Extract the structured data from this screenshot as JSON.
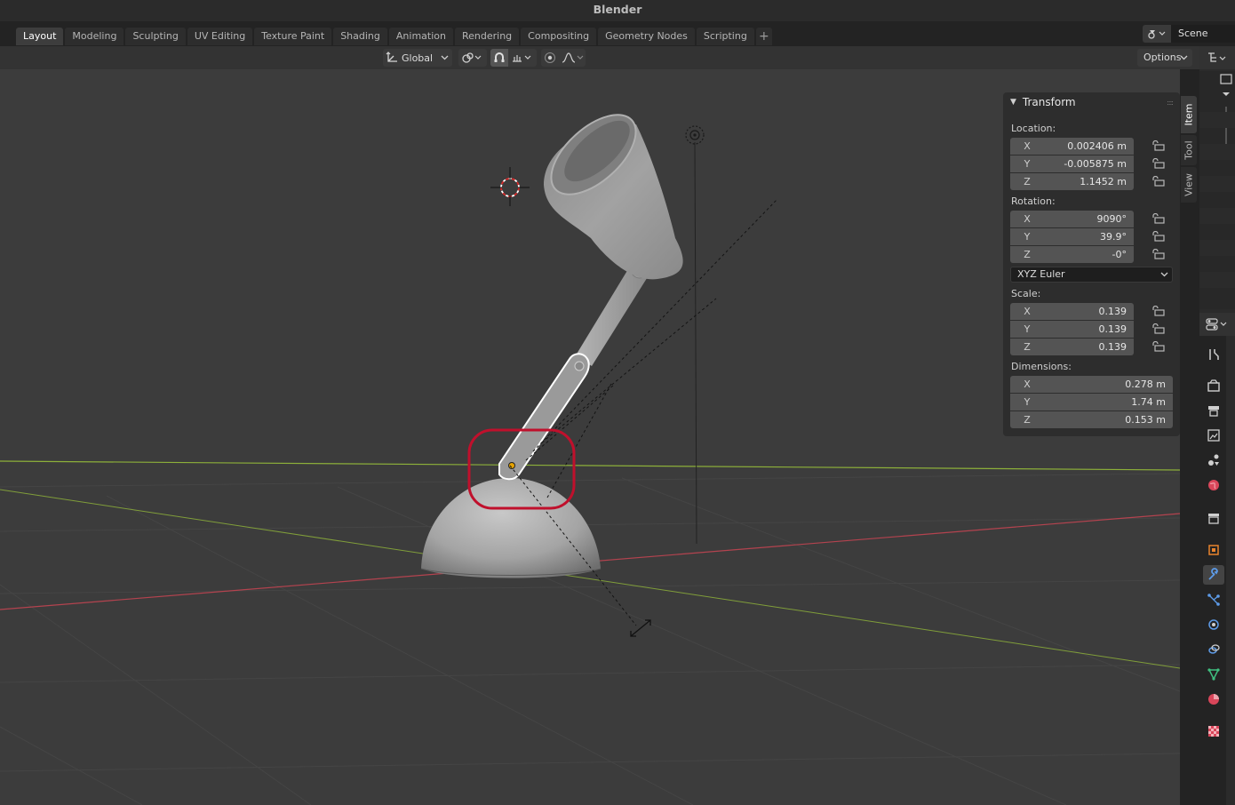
{
  "app": {
    "title": "Blender"
  },
  "workspace_tabs": [
    {
      "label": "Layout",
      "active": true
    },
    {
      "label": "Modeling"
    },
    {
      "label": "Sculpting"
    },
    {
      "label": "UV Editing"
    },
    {
      "label": "Texture Paint"
    },
    {
      "label": "Shading"
    },
    {
      "label": "Animation"
    },
    {
      "label": "Rendering"
    },
    {
      "label": "Compositing"
    },
    {
      "label": "Geometry Nodes"
    },
    {
      "label": "Scripting"
    }
  ],
  "add_workspace": "+",
  "scene": {
    "name": "Scene"
  },
  "header": {
    "orientation": "Global",
    "options_label": "Options"
  },
  "n_panel": {
    "section_title": "Transform",
    "location": {
      "label": "Location:",
      "x": "0.002406 m",
      "y": "-0.005875 m",
      "z": "1.1452 m"
    },
    "rotation": {
      "label": "Rotation:",
      "x": "9090°",
      "y": "39.9°",
      "z": "-0°"
    },
    "rotation_mode": "XYZ Euler",
    "scale": {
      "label": "Scale:",
      "x": "0.139",
      "y": "0.139",
      "z": "0.139"
    },
    "dimensions": {
      "label": "Dimensions:",
      "x": "0.278 m",
      "y": "1.74 m",
      "z": "0.153 m"
    },
    "axis_labels": {
      "x": "X",
      "y": "Y",
      "z": "Z"
    }
  },
  "side_tabs": [
    {
      "label": "Item",
      "active": true
    },
    {
      "label": "Tool"
    },
    {
      "label": "View"
    }
  ],
  "property_icons": [
    "tool-icon",
    "render-icon",
    "output-icon",
    "view-layer-icon",
    "scene-icon",
    "world-icon",
    "collection-icon",
    "object-icon",
    "modifier-icon",
    "particles-icon",
    "physics-icon",
    "constraints-icon",
    "data-icon",
    "material-icon",
    "texture-icon"
  ],
  "colors": {
    "viewport_bg": "#3c3c3c",
    "x_axis": "#b4434f",
    "y_axis": "#8db03a",
    "highlight_ring": "#c0102c",
    "active_tab": "#3d3d3d"
  }
}
